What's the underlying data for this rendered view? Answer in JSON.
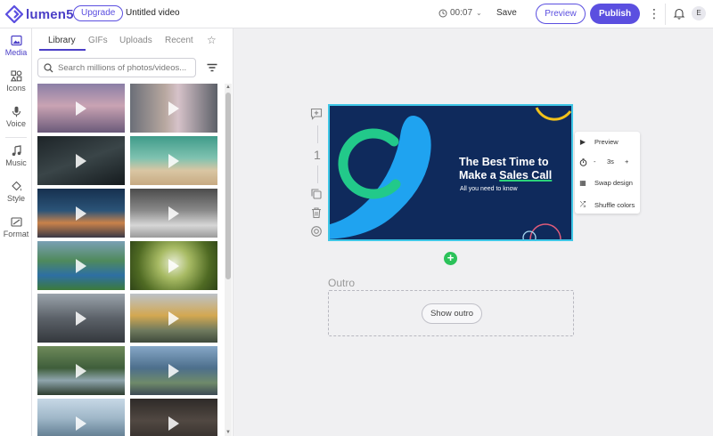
{
  "brand": {
    "name": "lumen5",
    "accent": "#5b4fe0"
  },
  "header": {
    "upgrade_label": "Upgrade",
    "video_title": "Untitled video",
    "duration": "00:07",
    "save_label": "Save",
    "preview_label": "Preview",
    "publish_label": "Publish",
    "avatar_initial": "E"
  },
  "rail": {
    "items": [
      {
        "label": "Media",
        "icon": "image-icon"
      },
      {
        "label": "Icons",
        "icon": "shapes-icon"
      },
      {
        "label": "Voice",
        "icon": "microphone-icon"
      },
      {
        "label": "Music",
        "icon": "music-note-icon"
      },
      {
        "label": "Style",
        "icon": "paint-bucket-icon"
      },
      {
        "label": "Format",
        "icon": "aspect-ratio-icon"
      }
    ]
  },
  "media": {
    "tabs": [
      "Library",
      "GIFs",
      "Uploads",
      "Recent"
    ],
    "search_placeholder": "Search millions of photos/videos..."
  },
  "scene": {
    "number": "1",
    "title_line1": "The Best Time to",
    "title_line2a": "Make a ",
    "title_line2b": "Sales Call",
    "subtitle": "All you need to know"
  },
  "scene_menu": {
    "preview": "Preview",
    "duration_minus": "-",
    "duration_value": "3s",
    "duration_plus": "+",
    "swap_design": "Swap design",
    "shuffle_colors": "Shuffle colors"
  },
  "outro": {
    "label": "Outro",
    "button": "Show outro"
  }
}
